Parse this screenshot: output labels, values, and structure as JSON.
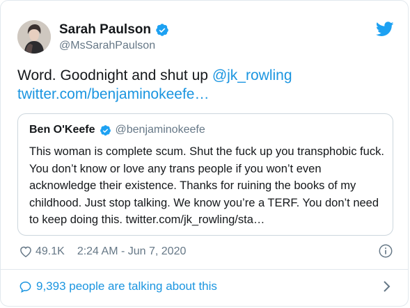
{
  "author": {
    "name": "Sarah Paulson",
    "handle": "@MsSarahPaulson"
  },
  "tweet": {
    "text_before": "Word. Goodnight and shut up ",
    "mention": "@jk_rowling",
    "link": "twitter.com/benjaminokeefe…"
  },
  "quoted": {
    "name": "Ben O'Keefe",
    "handle": "@benjaminokeefe",
    "text": "This woman is complete scum. Shut the fuck up you transphobic fuck. You don’t know or love any trans people if you won’t even acknowledge their existence. Thanks for ruining the books of my childhood. Just stop talking. We know you’re a TERF. You don’t need to keep doing this. twitter.com/jk_rowling/sta…"
  },
  "meta": {
    "likes": "49.1K",
    "timestamp": "2:24 AM - Jun 7, 2020"
  },
  "footer": {
    "talking": "9,393 people are talking about this"
  },
  "icons": {
    "verified": "verified-badge-icon",
    "brand": "twitter-bird-icon",
    "like": "heart-icon",
    "info": "info-icon",
    "reply": "speech-bubble-icon",
    "more": "chevron-right-icon"
  },
  "colors": {
    "link": "#1b95e0",
    "secondary_text": "#657786",
    "border": "#e1e8ed"
  }
}
